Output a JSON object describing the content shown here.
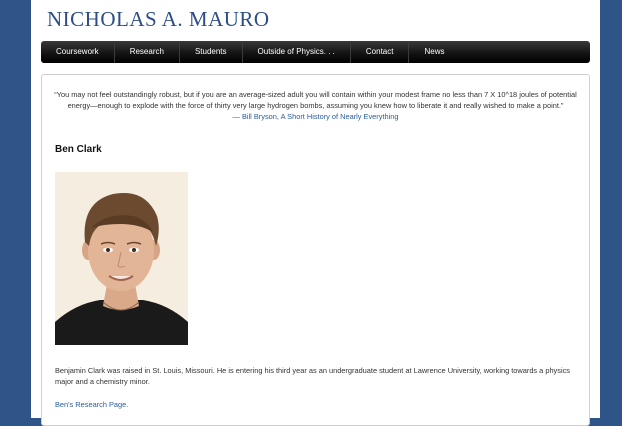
{
  "site": {
    "title": "NICHOLAS A. MAURO"
  },
  "nav": {
    "items": [
      {
        "label": "Coursework"
      },
      {
        "label": "Research"
      },
      {
        "label": "Students"
      },
      {
        "label": "Outside of Physics. . ."
      },
      {
        "label": "Contact"
      },
      {
        "label": "News"
      }
    ]
  },
  "quote": {
    "text": "“You may not feel outstandingly robust, but if you are an average-sized adult you will contain within your modest frame no less than 7 X 10^18 joules of potential energy—enough to explode with the force of thirty very large hydrogen bombs, assuming you knew how to liberate it and really wished to make a point.”",
    "dash": "— ",
    "author": "Bill Bryson",
    "separator": ", ",
    "book": "A Short History of Nearly Everything"
  },
  "profile": {
    "name": "Ben Clark",
    "bio": "Benjamin Clark was raised in St. Louis, Missouri. He is entering his third year as an undergraduate student at Lawrence University, working towards a physics major and a chemistry minor.",
    "research_link": "Ben's Research Page."
  },
  "colors": {
    "background": "#2f5588",
    "title": "#2d4d86",
    "link": "#2a5c9e",
    "nav": "#141414"
  }
}
